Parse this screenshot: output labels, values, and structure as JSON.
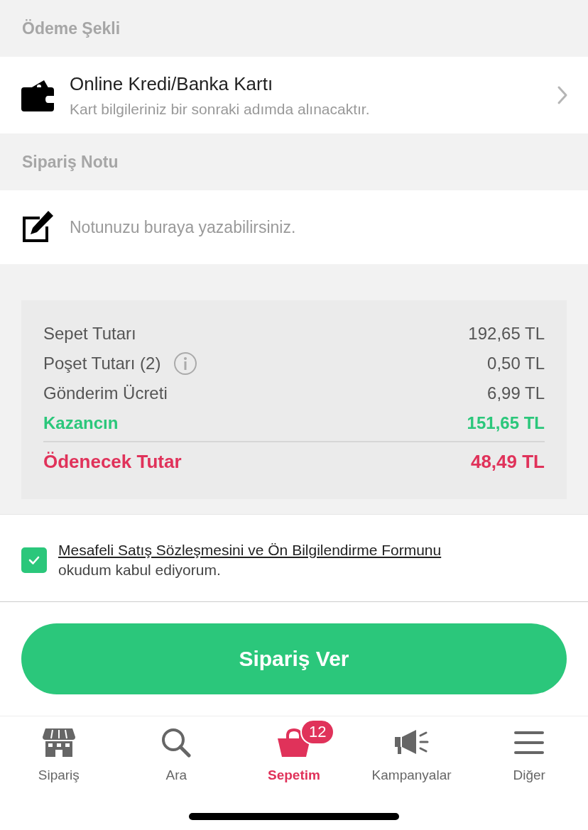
{
  "payment": {
    "header": "Ödeme Şekli",
    "title": "Online Kredi/Banka Kartı",
    "subtitle": "Kart bilgileriniz bir sonraki adımda alınacaktır."
  },
  "note": {
    "header": "Sipariş Notu",
    "placeholder": "Notunuzu buraya yazabilirsiniz."
  },
  "summary": [
    {
      "label": "Sepet Tutarı",
      "value": "192,65 TL",
      "kind": "normal",
      "info": false
    },
    {
      "label": "Poşet Tutarı (2)",
      "value": "0,50 TL",
      "kind": "normal",
      "info": true
    },
    {
      "label": "Gönderim Ücreti",
      "value": "6,99 TL",
      "kind": "normal",
      "info": false
    },
    {
      "label": "Kazancın",
      "value": "151,65 TL",
      "kind": "savings",
      "info": false
    },
    {
      "label": "Ödenecek Tutar",
      "value": "48,49 TL",
      "kind": "total",
      "info": false
    }
  ],
  "agreement": {
    "checked": true,
    "link": "Mesafeli Satış Sözleşmesini ve Ön Bilgilendirme Formunu",
    "text": "okudum kabul ediyorum."
  },
  "submit": "Sipariş Ver",
  "tabs": [
    {
      "label": "Sipariş",
      "selected": false
    },
    {
      "label": "Ara",
      "selected": false
    },
    {
      "label": "Sepetim",
      "selected": true,
      "badge": "12"
    },
    {
      "label": "Kampanyalar",
      "selected": false
    },
    {
      "label": "Diğer",
      "selected": false
    }
  ]
}
